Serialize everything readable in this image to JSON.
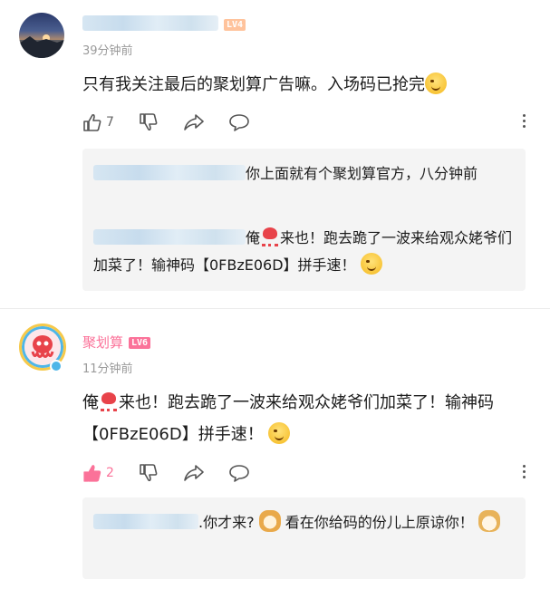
{
  "comments": [
    {
      "username": "",
      "level": "LV4",
      "time": "39分钟前",
      "content_text": "只有我关注最后的聚划算广告嘛。入场码已抢完",
      "content_emoji": "crying-laughing-emoji",
      "likes": "7",
      "replies": [
        {
          "text": "你上面就有个聚划算官方，八分钟前"
        },
        {
          "prefix": "俺",
          "emoji_inline": "octopus-emoji",
          "text": "来也！跑去跪了一波来给观众姥爷们加菜了！输神码【0FBzE06D】拼手速！",
          "emoji_end": "smirk-emoji"
        }
      ]
    },
    {
      "username": "聚划算",
      "level": "LV6",
      "time": "11分钟前",
      "content_prefix": "俺",
      "content_emoji_inline": "octopus-emoji",
      "content_text": "来也！跑去跪了一波来给观众姥爷们加菜了！输神码【0FBzE06D】拼手速！",
      "content_emoji_end": "smirk-emoji",
      "likes": "2",
      "replies": [
        {
          "text": ".你才来? ",
          "emoji_mid": "shiba-cat-emoji",
          "text2": "看在你给码的份儿上原谅你！",
          "emoji_end": "doge-emoji"
        }
      ]
    }
  ],
  "colors": {
    "accent": "#fb7299",
    "time": "#9a9a9a",
    "reply_bg": "#f4f4f4"
  }
}
